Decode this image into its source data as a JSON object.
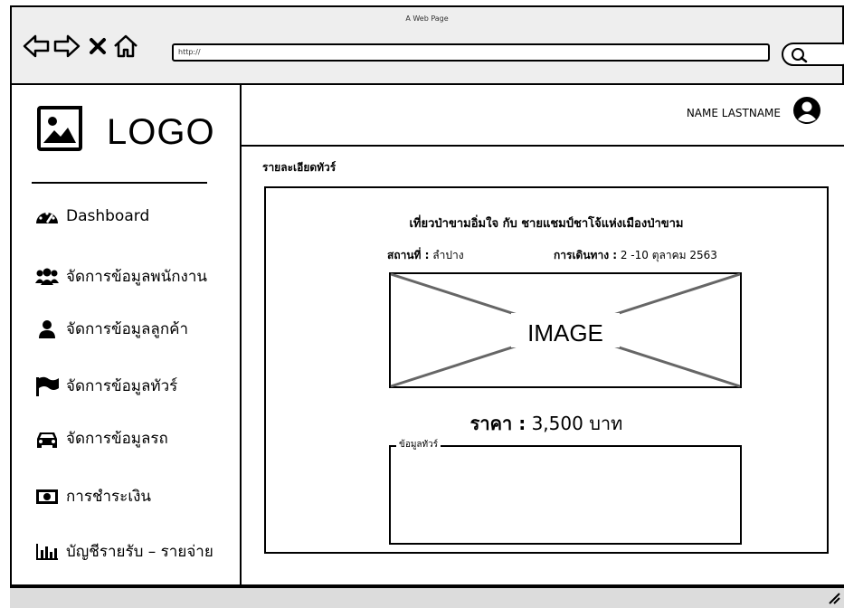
{
  "window": {
    "title": "A Web Page"
  },
  "browser": {
    "url": "http://"
  },
  "logo": {
    "text": "LOGO"
  },
  "user": {
    "name": "NAME LASTNAME"
  },
  "sidebar": {
    "items": [
      {
        "label": "Dashboard",
        "icon": "dashboard-icon"
      },
      {
        "label": "จัดการข้อมูลพนักงาน",
        "icon": "users-icon"
      },
      {
        "label": "จัดการข้อมูลลูกค้า",
        "icon": "user-icon"
      },
      {
        "label": "จัดการข้อมูลทัวร์",
        "icon": "flag-icon"
      },
      {
        "label": "จัดการข้อมูลรถ",
        "icon": "car-icon"
      },
      {
        "label": "การชำระเงิน",
        "icon": "money-icon"
      },
      {
        "label": "บัญชีรายรับ – รายจ่าย",
        "icon": "bar-chart-icon"
      }
    ]
  },
  "page": {
    "title": "รายละเอียดทัวร์"
  },
  "tour": {
    "name": "เที่ยวป่าขามอิ่มใจ กับ ชายแชมป์ชาโจ้แห่งเมืองป่าขาม",
    "place_label": "สถานที่ :",
    "place_value": "ลำปาง",
    "travel_label": "การเดินทาง :",
    "travel_value": "2 -10 ตุลาคม 2563",
    "image_text": "IMAGE",
    "price_label": "ราคา :",
    "price_value": "3,500 บาท",
    "info_label": "ข้อมูลทัวร์"
  }
}
